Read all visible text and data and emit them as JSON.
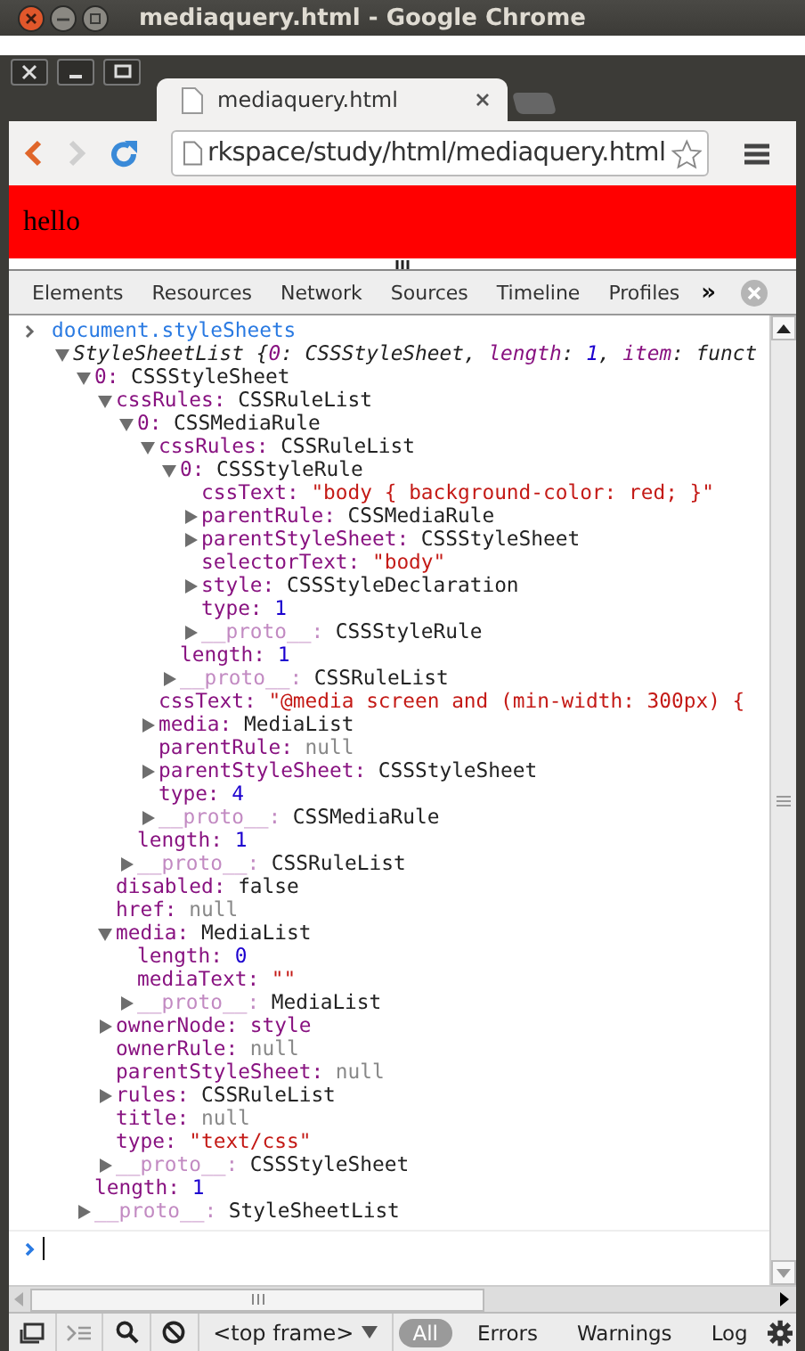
{
  "window": {
    "title": "mediaquery.html - Google Chrome"
  },
  "tab": {
    "title": "mediaquery.html"
  },
  "address_bar": {
    "value": "rkspace/study/html/mediaquery.html"
  },
  "page": {
    "text": "hello"
  },
  "devtools_tabs": [
    {
      "label": "Elements",
      "selected": false
    },
    {
      "label": "Resources",
      "selected": false
    },
    {
      "label": "Network",
      "selected": false
    },
    {
      "label": "Sources",
      "selected": false
    },
    {
      "label": "Timeline",
      "selected": false
    },
    {
      "label": "Profiles",
      "selected": false
    }
  ],
  "more_tabs": "»",
  "console": {
    "command": "document.styleSheets",
    "result": {
      "expanded": true,
      "preview": [
        {
          "text": "StyleSheetList {",
          "kind": "plain"
        },
        {
          "text": "0",
          "kind": "key"
        },
        {
          "text": ": CSSStyleSheet, ",
          "kind": "plain"
        },
        {
          "text": "length",
          "kind": "key"
        },
        {
          "text": ": ",
          "kind": "plain"
        },
        {
          "text": "1",
          "kind": "number"
        },
        {
          "text": ", ",
          "kind": "plain"
        },
        {
          "text": "item",
          "kind": "key"
        },
        {
          "text": ": funct",
          "kind": "plain"
        }
      ],
      "children": [
        {
          "key": "0:",
          "value": "CSSStyleSheet",
          "kind": "object",
          "expanded": true,
          "children": [
            {
              "key": "cssRules:",
              "value": "CSSRuleList",
              "kind": "object",
              "expanded": true,
              "children": [
                {
                  "key": "0:",
                  "value": "CSSMediaRule",
                  "kind": "object",
                  "expanded": true,
                  "children": [
                    {
                      "key": "cssRules:",
                      "value": "CSSRuleList",
                      "kind": "object",
                      "expanded": true,
                      "children": [
                        {
                          "key": "0:",
                          "value": "CSSStyleRule",
                          "kind": "object",
                          "expanded": true,
                          "children": [
                            {
                              "key": "cssText:",
                              "value": "\"body { background-color: red; }\"",
                              "kind": "string"
                            },
                            {
                              "key": "parentRule:",
                              "value": "CSSMediaRule",
                              "kind": "object",
                              "expanded": false
                            },
                            {
                              "key": "parentStyleSheet:",
                              "value": "CSSStyleSheet",
                              "kind": "object",
                              "expanded": false
                            },
                            {
                              "key": "selectorText:",
                              "value": "\"body\"",
                              "kind": "string"
                            },
                            {
                              "key": "style:",
                              "value": "CSSStyleDeclaration",
                              "kind": "object",
                              "expanded": false
                            },
                            {
                              "key": "type:",
                              "value": "1",
                              "kind": "number"
                            },
                            {
                              "key": "__proto__:",
                              "value": "CSSStyleRule",
                              "kind": "proto",
                              "expanded": false
                            }
                          ]
                        },
                        {
                          "key": "length:",
                          "value": "1",
                          "kind": "number"
                        },
                        {
                          "key": "__proto__:",
                          "value": "CSSRuleList",
                          "kind": "proto",
                          "expanded": false
                        }
                      ]
                    },
                    {
                      "key": "cssText:",
                      "value": "\"@media screen and (min-width: 300px) {",
                      "kind": "string"
                    },
                    {
                      "key": "media:",
                      "value": "MediaList",
                      "kind": "object",
                      "expanded": false
                    },
                    {
                      "key": "parentRule:",
                      "value": "null",
                      "kind": "null"
                    },
                    {
                      "key": "parentStyleSheet:",
                      "value": "CSSStyleSheet",
                      "kind": "object",
                      "expanded": false
                    },
                    {
                      "key": "type:",
                      "value": "4",
                      "kind": "number"
                    },
                    {
                      "key": "__proto__:",
                      "value": "CSSMediaRule",
                      "kind": "proto",
                      "expanded": false
                    }
                  ]
                },
                {
                  "key": "length:",
                  "value": "1",
                  "kind": "number"
                },
                {
                  "key": "__proto__:",
                  "value": "CSSRuleList",
                  "kind": "proto",
                  "expanded": false
                }
              ]
            },
            {
              "key": "disabled:",
              "value": "false",
              "kind": "object"
            },
            {
              "key": "href:",
              "value": "null",
              "kind": "null"
            },
            {
              "key": "media:",
              "value": "MediaList",
              "kind": "object",
              "expanded": true,
              "children": [
                {
                  "key": "length:",
                  "value": "0",
                  "kind": "number"
                },
                {
                  "key": "mediaText:",
                  "value": "\"\"",
                  "kind": "string"
                },
                {
                  "key": "__proto__:",
                  "value": "MediaList",
                  "kind": "proto",
                  "expanded": false
                }
              ]
            },
            {
              "key": "ownerNode:",
              "value": "style",
              "kind": "node",
              "expanded": false
            },
            {
              "key": "ownerRule:",
              "value": "null",
              "kind": "null"
            },
            {
              "key": "parentStyleSheet:",
              "value": "null",
              "kind": "null"
            },
            {
              "key": "rules:",
              "value": "CSSRuleList",
              "kind": "object",
              "expanded": false
            },
            {
              "key": "title:",
              "value": "null",
              "kind": "null"
            },
            {
              "key": "type:",
              "value": "\"text/css\"",
              "kind": "string"
            },
            {
              "key": "__proto__:",
              "value": "CSSStyleSheet",
              "kind": "proto",
              "expanded": false
            }
          ]
        },
        {
          "key": "length:",
          "value": "1",
          "kind": "number"
        },
        {
          "key": "__proto__:",
          "value": "StyleSheetList",
          "kind": "proto",
          "expanded": false
        }
      ]
    }
  },
  "bottom_bar": {
    "frame_select": "<top frame>",
    "filters": [
      {
        "label": "All",
        "selected": true
      },
      {
        "label": "Errors",
        "selected": false
      },
      {
        "label": "Warnings",
        "selected": false
      },
      {
        "label": "Log",
        "selected": false
      }
    ]
  }
}
